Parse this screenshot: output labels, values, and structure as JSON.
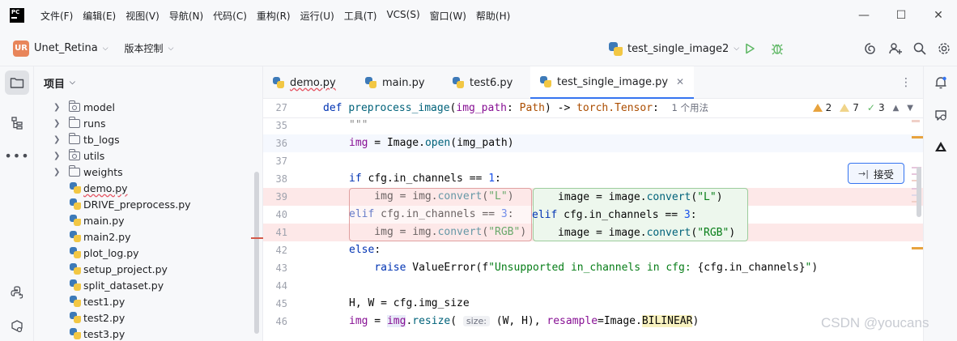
{
  "titlebar": {
    "menu": [
      "文件(F)",
      "编辑(E)",
      "视图(V)",
      "导航(N)",
      "代码(C)",
      "重构(R)",
      "运行(U)",
      "工具(T)",
      "VCS(S)",
      "窗口(W)",
      "帮助(H)"
    ],
    "minimize": "—",
    "maximize": "☐",
    "close": "✕"
  },
  "toolbar": {
    "project_badge": "UR",
    "project_name": "Unet_Retina",
    "vcs_label": "版本控制",
    "run_config": "test_single_image2"
  },
  "project_panel": {
    "title": "项目",
    "items": [
      {
        "label": "model",
        "kind": "package"
      },
      {
        "label": "runs",
        "kind": "folder"
      },
      {
        "label": "tb_logs",
        "kind": "folder"
      },
      {
        "label": "utils",
        "kind": "package"
      },
      {
        "label": "weights",
        "kind": "folder"
      },
      {
        "label": "demo.py",
        "kind": "python"
      },
      {
        "label": "DRIVE_preprocess.py",
        "kind": "python"
      },
      {
        "label": "main.py",
        "kind": "python"
      },
      {
        "label": "main2.py",
        "kind": "python"
      },
      {
        "label": "plot_log.py",
        "kind": "python"
      },
      {
        "label": "setup_project.py",
        "kind": "python"
      },
      {
        "label": "split_dataset.py",
        "kind": "python"
      },
      {
        "label": "test1.py",
        "kind": "python"
      },
      {
        "label": "test2.py",
        "kind": "python"
      },
      {
        "label": "test3.py",
        "kind": "python"
      }
    ]
  },
  "tabs": [
    {
      "label": "demo.py"
    },
    {
      "label": "main.py"
    },
    {
      "label": "test6.py"
    },
    {
      "label": "test_single_image.py"
    }
  ],
  "tab_close": "✕",
  "editor": {
    "sticky_line_number": "27",
    "sticky_def": "def",
    "sticky_fn": "preprocess_image",
    "sticky_param": "img_path",
    "sticky_type": "Path",
    "sticky_ret": "torch.Tensor",
    "usages": "1 个用法",
    "inspections": {
      "warnings": "2",
      "weak_warnings": "7",
      "typos": "3"
    },
    "line_numbers": [
      "35",
      "36",
      "37",
      "38",
      "39",
      "40",
      "41",
      "42",
      "43",
      "44",
      "45",
      "46"
    ],
    "line_35": "\"\"\"",
    "line_36": {
      "var": "img",
      "rest": " = Image.",
      "call": "open",
      "arg": "img_path"
    },
    "line_38": {
      "kw": "if",
      "cond": " cfg.in_channels == ",
      "num": "1",
      "colon": ":"
    },
    "line_39": {
      "pre": "    img = img.",
      "call": "convert",
      "str": "\"L\""
    },
    "line_40": {
      "kw": "elif",
      "cond": " cfg.in_channels == ",
      "num": "3",
      "colon": ":"
    },
    "line_41": {
      "pre": "    img = img.",
      "call": "convert",
      "str": "\"RGB\""
    },
    "line_42": {
      "kw": "else",
      "colon": ":"
    },
    "line_43": {
      "kw": "raise",
      "exc": " ValueError(f",
      "str": "\"Unsupported in_channels in cfg: ",
      "expr": "{cfg.in_channels}",
      "str_end": "\"",
      "close": ")"
    },
    "line_45": "H, W = cfg.img_size",
    "line_46": {
      "var": "img",
      "mid": " = ",
      "obj": "img",
      "dot": ".",
      "call": "resize",
      "hint": "size:",
      "args": " (W, H), ",
      "kwarg": "resample",
      "eq": "=Image.",
      "const": "BILINEAR",
      "close": ")"
    },
    "suggestion": {
      "line_1": {
        "pre": "image = image.",
        "call": "convert",
        "str": "\"L\""
      },
      "line_2": {
        "kw": "elif",
        "cond": " cfg.in_channels == ",
        "num": "3",
        "colon": ":"
      },
      "line_3": {
        "pre": "image = image.",
        "call": "convert",
        "str": "\"RGB\""
      }
    },
    "accept_label": "接受",
    "accept_icon": "→|"
  },
  "watermark": "CSDN @youcans",
  "colors": {
    "accent": "#3574f0",
    "keyword": "#0033b3",
    "string": "#067d17",
    "number": "#1750eb",
    "warning": "#e8a33e"
  }
}
